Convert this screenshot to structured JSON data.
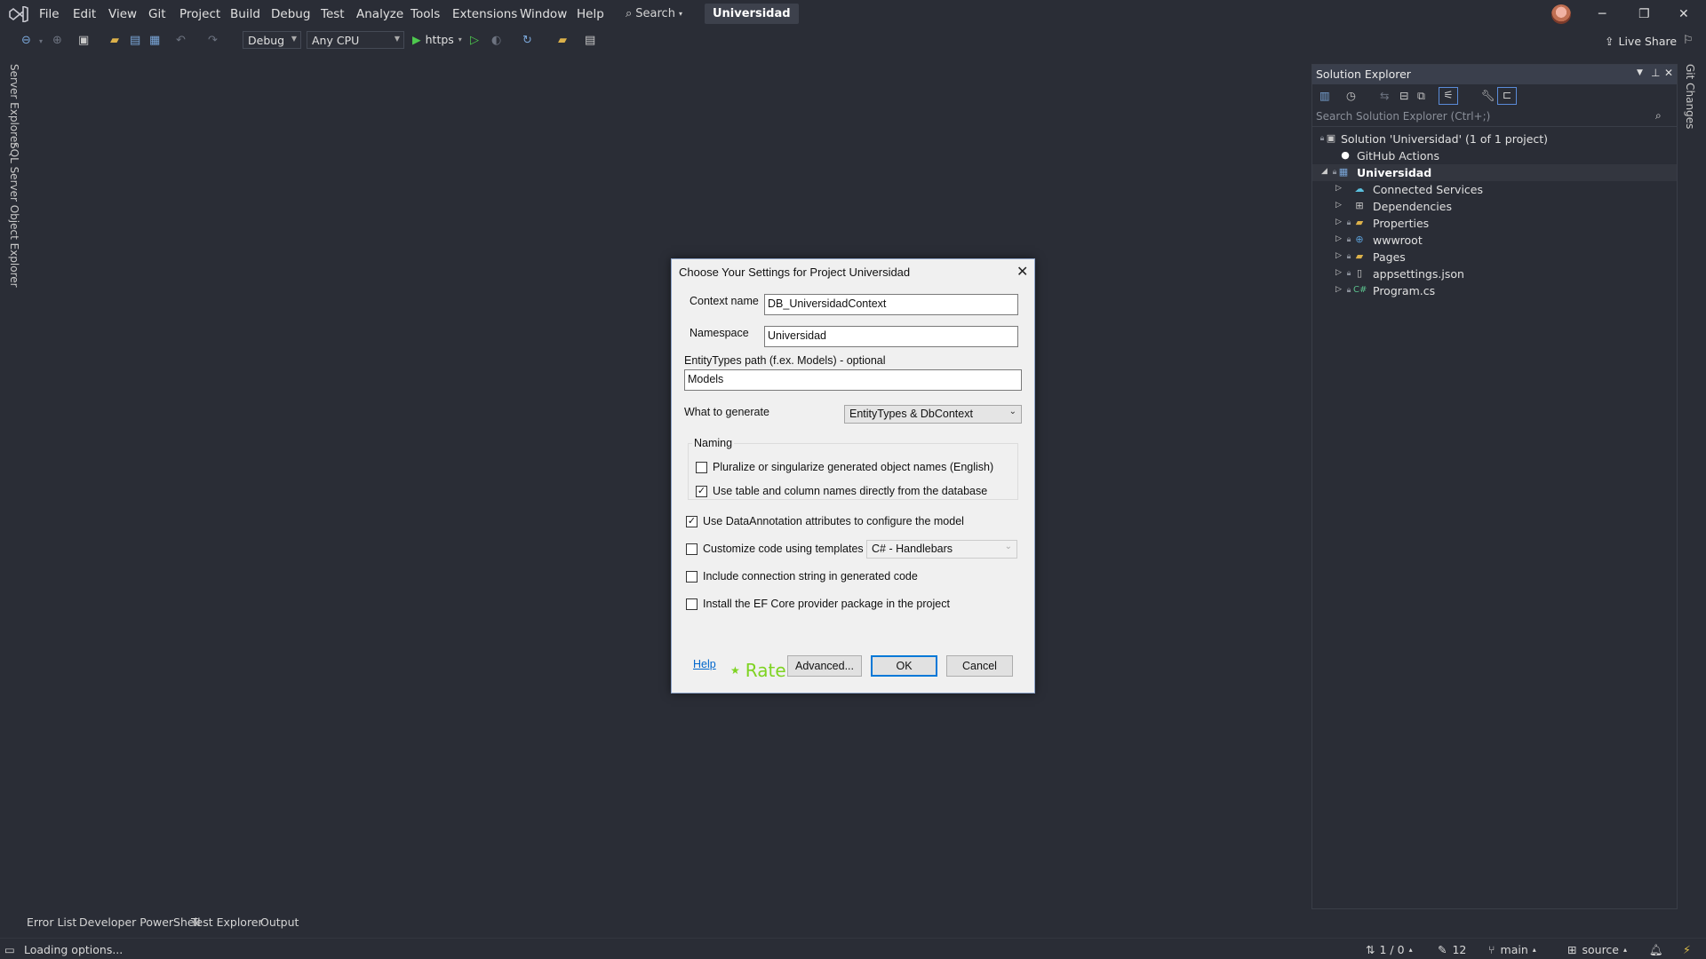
{
  "menu": {
    "items": [
      "File",
      "Edit",
      "View",
      "Git",
      "Project",
      "Build",
      "Debug",
      "Test",
      "Analyze",
      "Tools",
      "Extensions",
      "Window",
      "Help"
    ],
    "search_label": "Search",
    "project_badge": "Universidad"
  },
  "toolbar": {
    "config": "Debug",
    "platform": "Any CPU",
    "run_target": "https",
    "live_share": "Live Share"
  },
  "left_tabs": {
    "server_explorer": "Server Explorer",
    "sql_explorer": "SQL Server Object Explorer"
  },
  "right_tab": "Git Changes",
  "solution_explorer": {
    "title": "Solution Explorer",
    "search_placeholder": "Search Solution Explorer (Ctrl+;)",
    "solution": "Solution 'Universidad' (1 of 1 project)",
    "github_actions": "GitHub Actions",
    "project": "Universidad",
    "children": [
      "Connected Services",
      "Dependencies",
      "Properties",
      "wwwroot",
      "Pages",
      "appsettings.json",
      "Program.cs"
    ]
  },
  "dialog": {
    "title": "Choose Your Settings for Project Universidad",
    "context_label": "Context name",
    "context_value": "DB_UniversidadContext",
    "namespace_label": "Namespace",
    "namespace_value": "Universidad",
    "entitytypes_label": "EntityTypes path (f.ex. Models) - optional",
    "entitytypes_value": "Models",
    "generate_label": "What to generate",
    "generate_value": "EntityTypes & DbContext",
    "naming_label": "Naming",
    "pluralize_label": "Pluralize or singularize generated object names (English)",
    "pluralize_checked": false,
    "use_names_label": "Use table and column names directly from the database",
    "use_names_checked": true,
    "dataannotation_label": "Use DataAnnotation attributes to configure the model",
    "dataannotation_checked": true,
    "templates_label": "Customize code using templates",
    "templates_checked": false,
    "templates_value": "C# - Handlebars",
    "connstring_label": "Include connection string in generated code",
    "connstring_checked": false,
    "install_label": "Install the EF Core provider package in the project",
    "install_checked": false,
    "help": "Help",
    "rate": "Rate",
    "advanced": "Advanced...",
    "ok": "OK",
    "cancel": "Cancel"
  },
  "bottom_tabs": [
    "Error List",
    "Developer PowerShell",
    "Test Explorer",
    "Output"
  ],
  "status": {
    "message": "Loading options...",
    "errors": "1 / 0",
    "changes": "12",
    "branch": "main",
    "repo": "source"
  },
  "colors": {
    "accent": "#0078d7",
    "rate": "#7ed321",
    "background": "#2a2d36"
  }
}
